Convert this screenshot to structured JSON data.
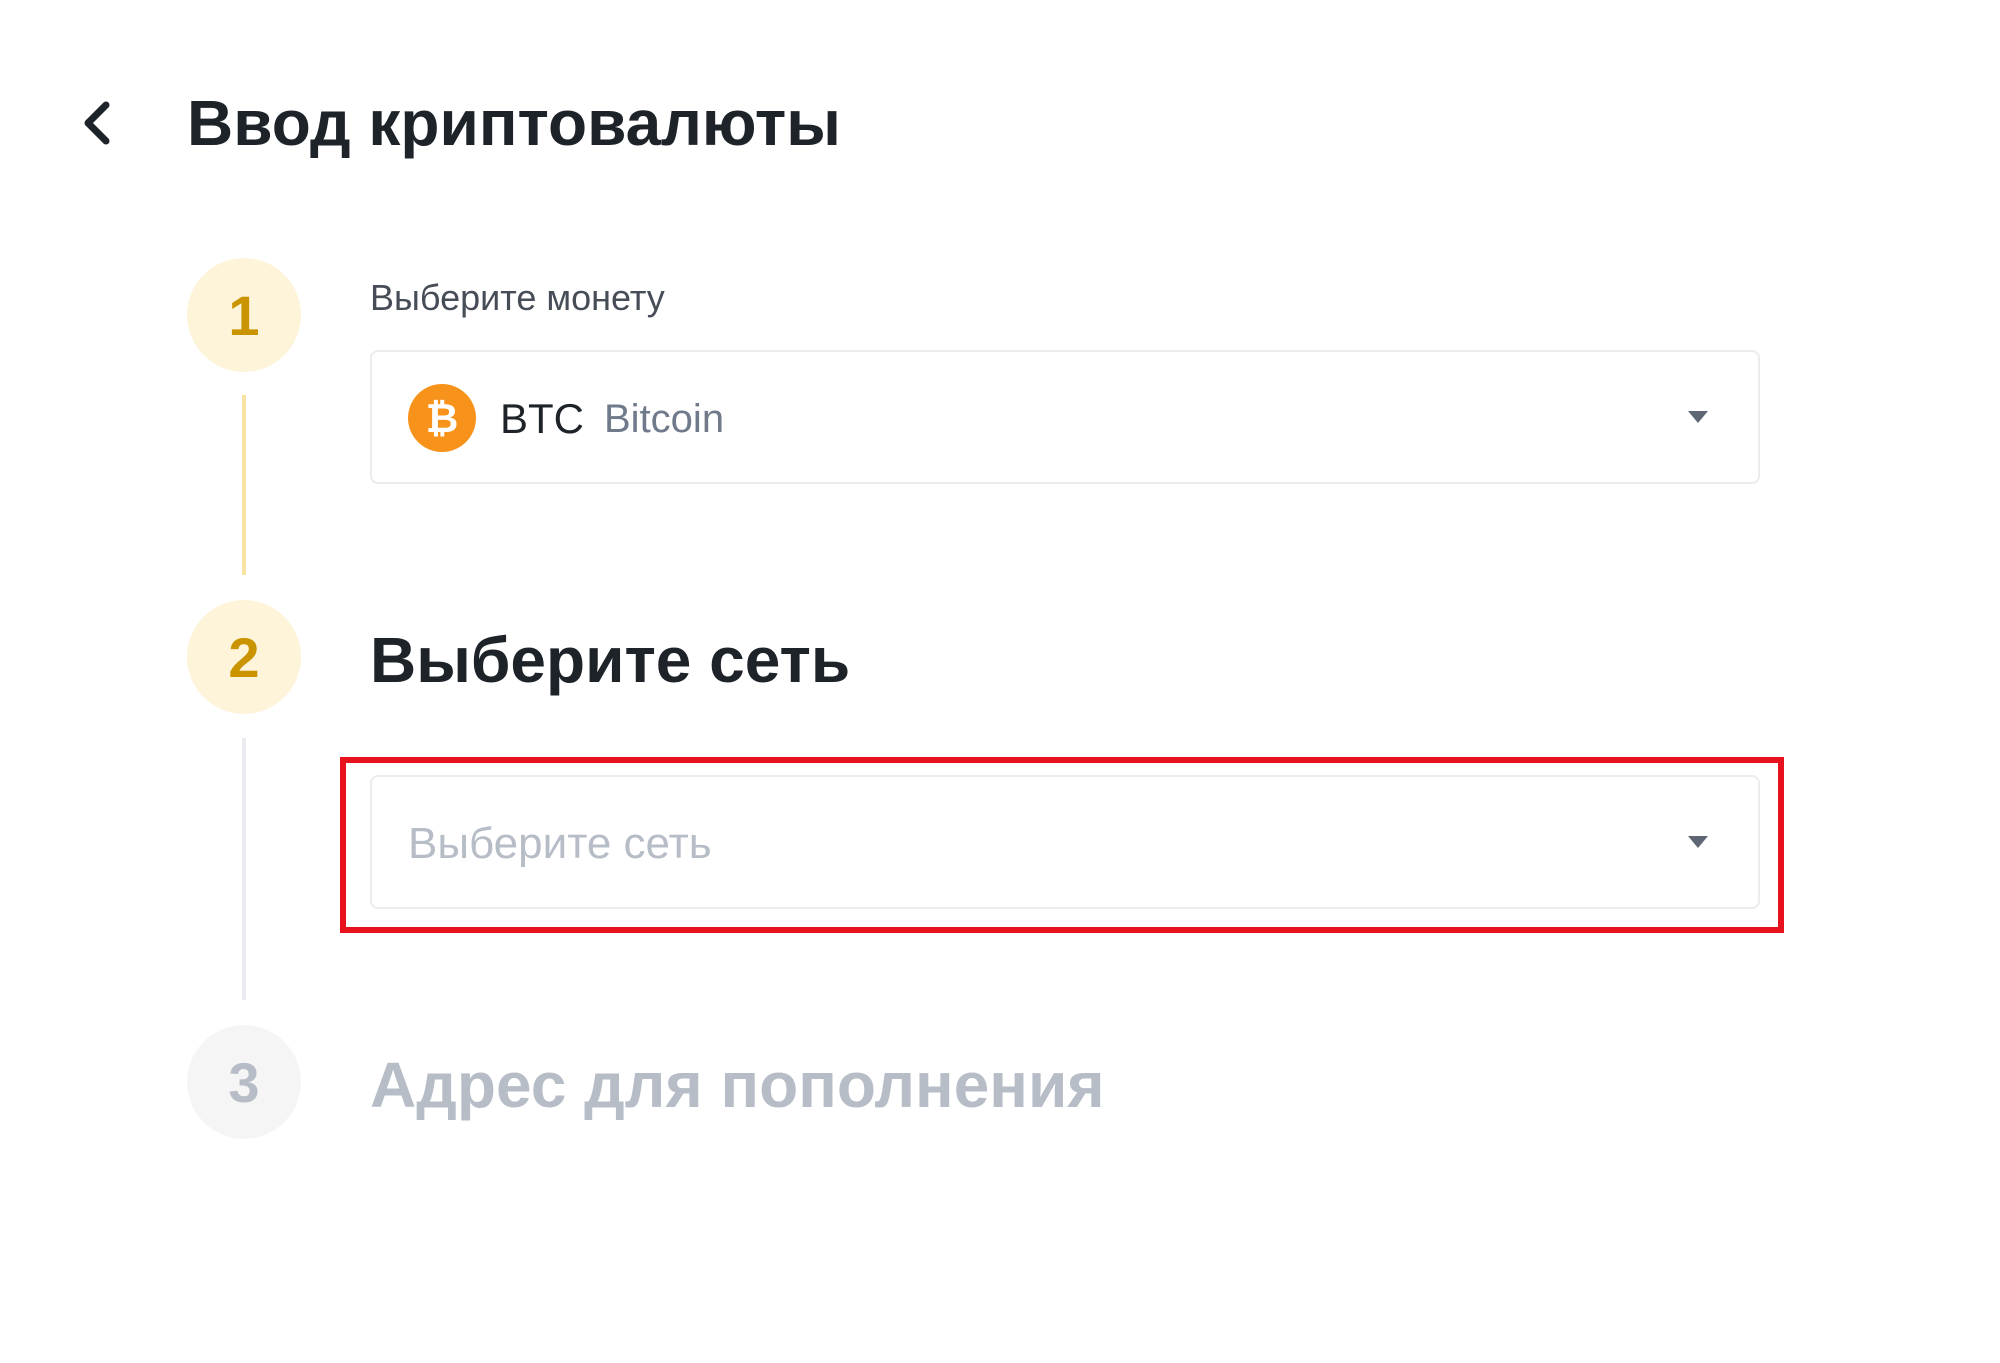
{
  "header": {
    "back_icon": "chevron-left-icon",
    "title": "Ввод криптовалюты"
  },
  "steps": [
    {
      "number": "1",
      "label": "Выберите монету",
      "state": "active",
      "select": {
        "coin_icon": "bitcoin-icon",
        "coin_icon_glyph": "₿",
        "ticker": "BTC",
        "name": "Bitcoin",
        "dropdown_icon": "caret-down-icon"
      }
    },
    {
      "number": "2",
      "label": "Выберите сеть",
      "state": "active",
      "select": {
        "placeholder": "Выберите сеть",
        "dropdown_icon": "caret-down-icon"
      }
    },
    {
      "number": "3",
      "label": "Адрес для пополнения",
      "state": "inactive"
    }
  ],
  "colors": {
    "accent": "#c99400",
    "accent_bg": "#fdf4d9",
    "bitcoin": "#f7931a",
    "highlight": "#e8121f",
    "inactive": "#b7bdc6"
  }
}
